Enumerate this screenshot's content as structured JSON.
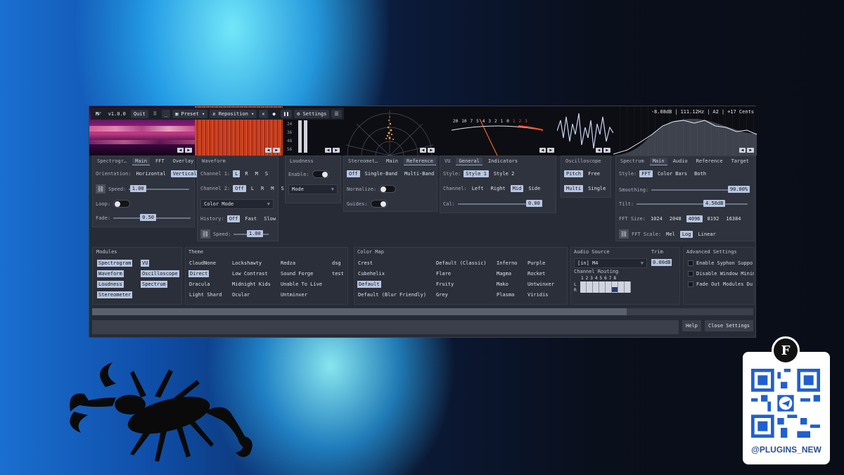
{
  "toolbar": {
    "version": "v1.0.0",
    "quit": "Quit",
    "minimize": "_",
    "preset": "Preset",
    "reposition": "Reposition",
    "settings": "Settings"
  },
  "readout": {
    "level": "-8.08dB",
    "freq": "111.12Hz",
    "note": "A2",
    "cents": "+17 Cents"
  },
  "loudness_scale": [
    "24",
    "36",
    "48",
    "56"
  ],
  "vu_scale": [
    "20",
    "10",
    "7",
    "5",
    "4",
    "3",
    "2",
    "1",
    "0",
    "1",
    "2",
    "3"
  ],
  "spectrogram": {
    "tabs": [
      "Spectrogr…",
      "Main",
      "FFT",
      "Overlay"
    ],
    "orientation_label": "Orientation:",
    "orientation_opts": [
      "Horizontal",
      "Vertical"
    ],
    "speed_label": "Speed:",
    "speed_value": "1.00",
    "speed_fraction": 0.15,
    "loop_label": "Loop:",
    "fade_label": "Fade:",
    "fade_value": "0.50",
    "fade_fraction": 0.45
  },
  "waveform": {
    "tabs": [
      "Waveform"
    ],
    "ch1_label": "Channel 1:",
    "ch1_opts": [
      "L",
      "R",
      "M",
      "S"
    ],
    "ch2_label": "Channel 2:",
    "ch2_opts": [
      "Off",
      "L",
      "R",
      "M",
      "S"
    ],
    "color_mode": "Color Mode",
    "history_label": "History:",
    "history_opts": [
      "Off",
      "Fast",
      "Slow"
    ],
    "speed_label": "Speed:",
    "speed_value": "1.00",
    "speed_fraction": 0.6
  },
  "loudness": {
    "tabs": [
      "Loudness"
    ],
    "enable_label": "Enable:",
    "mode": "Mode"
  },
  "stereometer": {
    "tabs": [
      "Stereomet…",
      "Main",
      "Reference"
    ],
    "band_opts": [
      "Off",
      "Single-Band",
      "Multi-Band"
    ],
    "normalize_label": "Normalize:",
    "guides_label": "Guides:"
  },
  "vu": {
    "tabs": [
      "VU",
      "General",
      "Indicators"
    ],
    "style_label": "Style:",
    "style_opts": [
      "Style 1",
      "Style 2"
    ],
    "channel_label": "Channel:",
    "channel_opts": [
      "Left",
      "Right",
      "Mid",
      "Side"
    ],
    "cal_label": "Cal:",
    "cal_value": "0.00",
    "cal_fraction": 0.95
  },
  "oscilloscope": {
    "tabs": [
      "Oscilloscope"
    ],
    "mode_opts": [
      "Pitch",
      "Free"
    ],
    "chan_opts": [
      "Multi",
      "Single"
    ]
  },
  "spectrum": {
    "tabs": [
      "Spectrum",
      "Main",
      "Audio",
      "Reference",
      "Target"
    ],
    "style_label": "Style:",
    "style_opts": [
      "FFT",
      "Color Bars",
      "Both"
    ],
    "smoothing_label": "Smoothing:",
    "smoothing_value": "90.00%",
    "smoothing_fraction": 0.9,
    "tilt_label": "Tilt:",
    "tilt_value": "4.50dB",
    "tilt_fraction": 0.7,
    "fft_size_label": "FFT Size:",
    "fft_sizes": [
      "1024",
      "2048",
      "4096",
      "8192",
      "16384"
    ],
    "fft_scale_label": "FFT Scale:",
    "fft_scales": [
      "Mel",
      "Log",
      "Linear"
    ]
  },
  "modules": {
    "title": "Modules",
    "items": [
      "Spectrogram",
      "Waveform",
      "Loudness",
      "Stereometer",
      "VU",
      "Oscilloscope",
      "Spectrum"
    ]
  },
  "theme": {
    "title": "Theme",
    "items": [
      "CloudNone",
      "Direct",
      "Dracula",
      "Light Shard",
      "Lockshawty",
      "Low Contrast",
      "Midnight Kids",
      "Ocular",
      "Redza",
      "Sound Forge",
      "Unable To Live",
      "Untminxer",
      "dsg",
      "test"
    ]
  },
  "colormap": {
    "title": "Color Map",
    "items": [
      "Crest",
      "Cubehelix",
      "Default",
      "Default (Blur Friendly)",
      "Default (Classic)",
      "Flare",
      "Fruity",
      "Grey",
      "Inferno",
      "Magma",
      "Mako",
      "Plasma",
      "Purple",
      "Rocket",
      "Untwinxer",
      "Viridis"
    ]
  },
  "audio": {
    "title": "Audio Source",
    "source": "[in] M4",
    "trim_label": "Trim",
    "trim_value": "0.00dB",
    "routing_label": "Channel Routing",
    "routing_cols": [
      "1",
      "2",
      "3",
      "4",
      "5",
      "6",
      "7",
      "8"
    ],
    "routing_rows": [
      "L",
      "R"
    ]
  },
  "advanced": {
    "title": "Advanced Settings",
    "items": [
      "Enable Syphon Suppo",
      "Disable Window Minim",
      "Fade Out Modules Du"
    ]
  },
  "footer": {
    "help": "Help",
    "close": "Close Settings"
  },
  "qr": {
    "handle": "@PLUGINS_NEW"
  }
}
